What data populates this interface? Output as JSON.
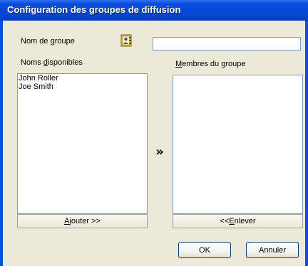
{
  "window": {
    "title": "Configuration des groupes de diffusion"
  },
  "group_name": {
    "label_pre": "Nom de ",
    "label_mnemonic": "g",
    "label_post": "roupe",
    "value": ""
  },
  "available": {
    "label_pre": "Noms ",
    "label_mnemonic": "d",
    "label_post": "isponibles",
    "items": [
      "John Roller",
      "Joe Smith"
    ],
    "add_button": {
      "mnemonic": "A",
      "rest": "jouter >>"
    }
  },
  "members": {
    "label_pre": "",
    "label_mnemonic": "M",
    "label_post": "embres du groupe",
    "items": [],
    "remove_button": {
      "pre": "<< ",
      "mnemonic": "E",
      "rest": "nlever"
    }
  },
  "transfer_arrow": "»",
  "buttons": {
    "ok": "OK",
    "cancel": "Annuler"
  },
  "icons": {
    "group_icon": "address-book-icon"
  }
}
